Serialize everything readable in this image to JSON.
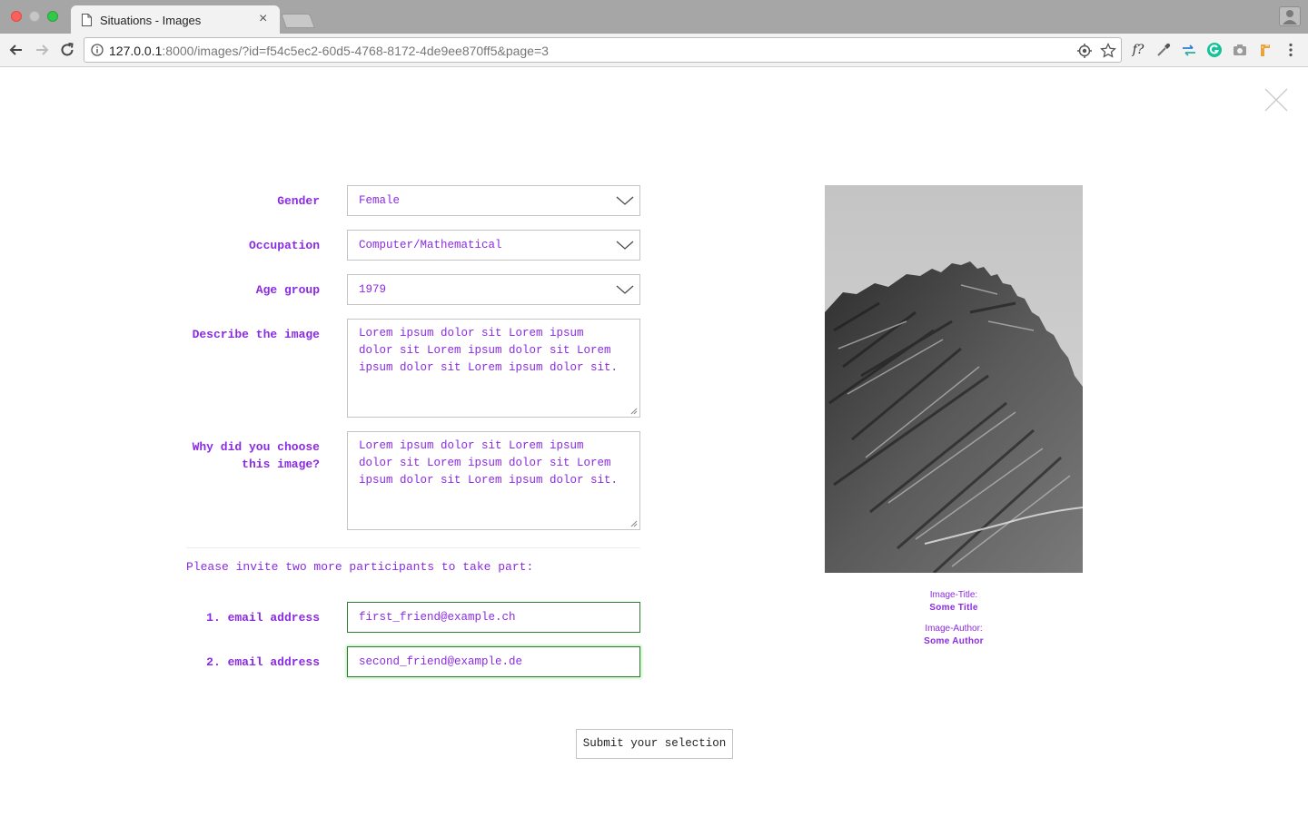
{
  "browser": {
    "tab_title": "Situations - Images",
    "url_host": "127.0.0.1",
    "url_rest": ":8000/images/?id=f54c5ec2-60d5-4768-8172-4de9ee870ff5&page=3",
    "extension_f_label": "f?"
  },
  "form": {
    "gender_label": "Gender",
    "gender_value": "Female",
    "occupation_label": "Occupation",
    "occupation_value": "Computer/Mathematical",
    "age_label": "Age group",
    "age_value": "1979",
    "describe_label": "Describe the image",
    "describe_value": "Lorem ipsum dolor sit Lorem ipsum dolor sit Lorem ipsum dolor sit Lorem ipsum dolor sit Lorem ipsum dolor sit.",
    "why_label_line1": "Why did you choose",
    "why_label_line2": "this image?",
    "why_value": "Lorem ipsum dolor sit Lorem ipsum dolor sit Lorem ipsum dolor sit Lorem ipsum dolor sit Lorem ipsum dolor sit.",
    "invite_text": "Please invite two more participants to take part:",
    "email1_label": "1. email address",
    "email1_value": "first_friend@example.ch",
    "email2_label": "2. email address",
    "email2_value": "second_friend@example.de",
    "submit_label": "Submit your selection"
  },
  "image_info": {
    "title_label": "Image-Title:",
    "title_value": "Some Title",
    "author_label": "Image-Author:",
    "author_value": "Some Author"
  },
  "colors": {
    "accent": "#8a2be2",
    "valid_border": "#2f7d2f"
  }
}
